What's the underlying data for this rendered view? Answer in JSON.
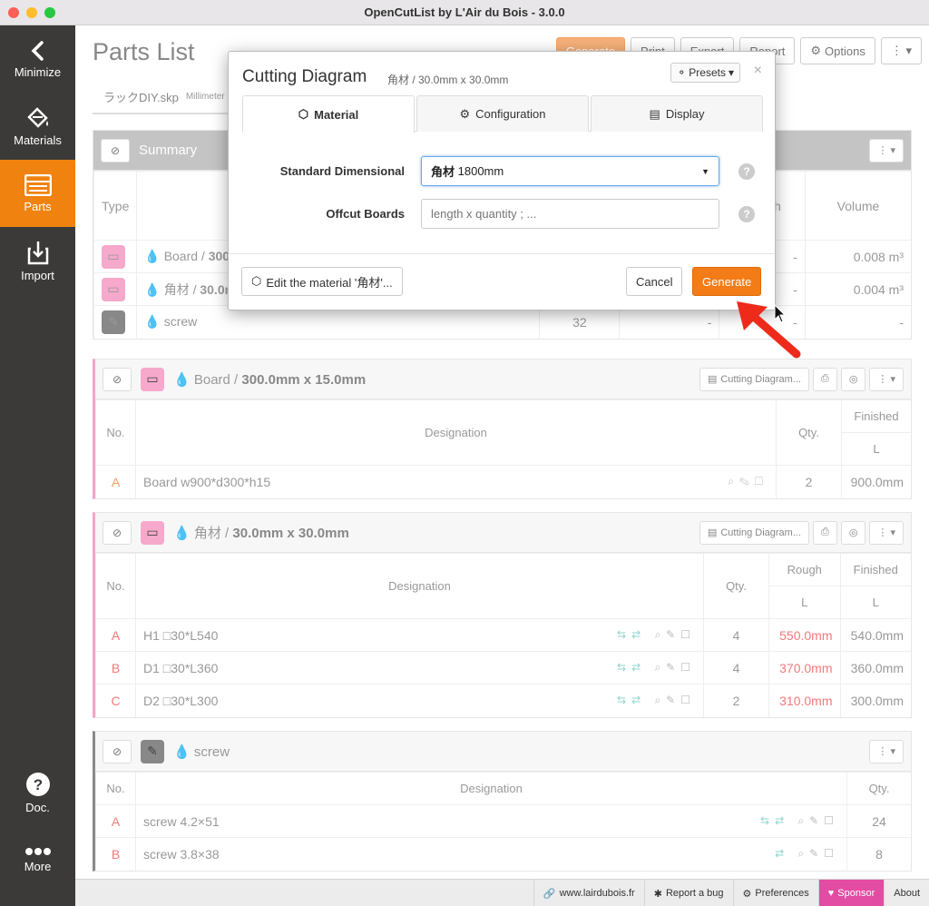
{
  "window": {
    "title": "OpenCutList by L'Air du Bois - 3.0.0"
  },
  "sidebar": {
    "items": [
      {
        "label": "Minimize",
        "icon": "chevron-left-icon"
      },
      {
        "label": "Materials",
        "icon": "paint-bucket-icon"
      },
      {
        "label": "Parts",
        "icon": "list-icon",
        "active": true
      },
      {
        "label": "Import",
        "icon": "import-icon"
      },
      {
        "label": "Doc.",
        "icon": "help-icon"
      },
      {
        "label": "More",
        "icon": "more-icon"
      }
    ]
  },
  "main": {
    "page_title": "Parts List",
    "toolbar": {
      "generate": "Generate",
      "print": "Print",
      "export": "Export",
      "report": "Report",
      "options": "Options"
    },
    "file": {
      "name": "ラックDIY.skp",
      "unit": "Millimeter"
    }
  },
  "summary": {
    "title": "Summary",
    "col_type": "Type",
    "col_rough": "Rough",
    "col_volume": "Volume",
    "rows": [
      {
        "name": "Board",
        "dims": "300",
        "dash": "-",
        "volume": "0.008 m³"
      },
      {
        "name": "角材",
        "dims": "30.0m",
        "dash": "-",
        "volume": "0.004 m³"
      },
      {
        "name": "screw",
        "count": "32",
        "dash1": "-",
        "dash2": "-",
        "dash3": "-"
      }
    ]
  },
  "group_board": {
    "title_name": "Board",
    "title_dims": "300.0mm x 15.0mm",
    "cutting_btn": "Cutting Diagram...",
    "headers": {
      "no": "No.",
      "designation": "Designation",
      "qty": "Qty.",
      "finished": "Finished",
      "l": "L"
    },
    "rows": [
      {
        "no": "A",
        "designation": "Board w900*d300*h15",
        "qty": "2",
        "finished": "900.0mm"
      }
    ]
  },
  "group_kakuzai": {
    "title_name": "角材",
    "title_dims": "30.0mm x 30.0mm",
    "cutting_btn": "Cutting Diagram...",
    "headers": {
      "no": "No.",
      "designation": "Designation",
      "qty": "Qty.",
      "rough": "Rough",
      "finished": "Finished",
      "l": "L"
    },
    "rows": [
      {
        "no": "A",
        "designation": "H1 □30*L540",
        "qty": "4",
        "rough": "550.0mm",
        "finished": "540.0mm"
      },
      {
        "no": "B",
        "designation": "D1 □30*L360",
        "qty": "4",
        "rough": "370.0mm",
        "finished": "360.0mm"
      },
      {
        "no": "C",
        "designation": "D2 □30*L300",
        "qty": "2",
        "rough": "310.0mm",
        "finished": "300.0mm"
      }
    ]
  },
  "group_screw": {
    "title_name": "screw",
    "headers": {
      "no": "No.",
      "designation": "Designation",
      "qty": "Qty."
    },
    "rows": [
      {
        "no": "A",
        "designation": "screw 4.2×51",
        "qty": "24"
      },
      {
        "no": "B",
        "designation": "screw 3.8×38",
        "qty": "8"
      }
    ]
  },
  "statusbar": {
    "website": "www.lairdubois.fr",
    "report_bug": "Report a bug",
    "preferences": "Preferences",
    "sponsor": "Sponsor",
    "about": "About"
  },
  "modal": {
    "title": "Cutting Diagram",
    "subtitle": "角材 / 30.0mm x 30.0mm",
    "presets": "Presets",
    "tabs": [
      "Material",
      "Configuration",
      "Display"
    ],
    "standard_label": "Standard Dimensional",
    "standard_value_name": "角材",
    "standard_value": "1800mm",
    "offcut_label": "Offcut Boards",
    "offcut_placeholder": "length x quantity ; ...",
    "edit_material": "Edit the material '角材'...",
    "cancel": "Cancel",
    "generate": "Generate"
  },
  "colors": {
    "accent": "#f37c17",
    "sidebar": "#3c3a38",
    "pink": "#f6a9cb",
    "sponsor": "#e24ca2"
  }
}
